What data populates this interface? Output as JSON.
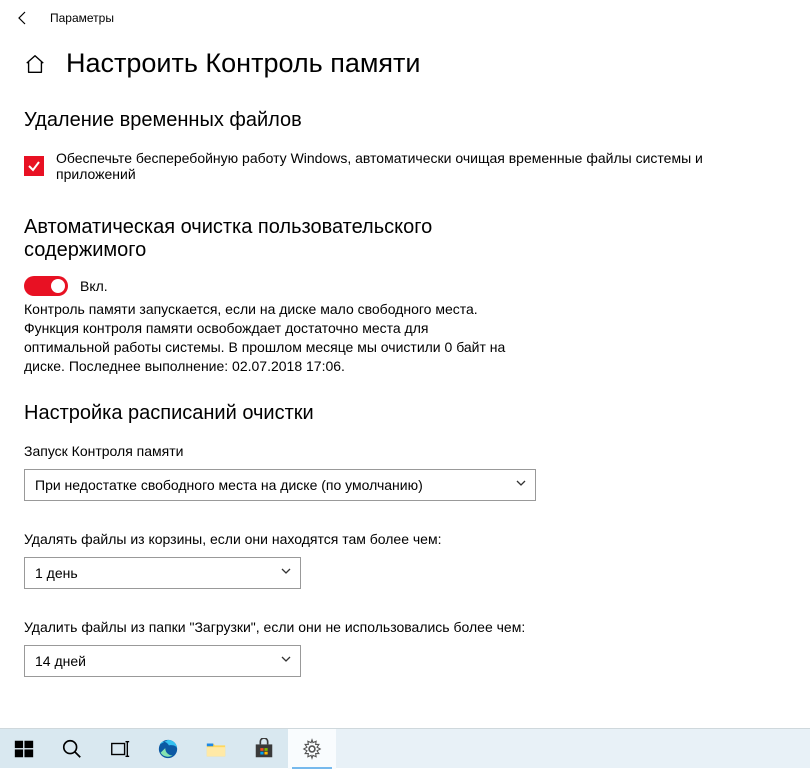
{
  "titlebar": {
    "label": "Параметры"
  },
  "page": {
    "title": "Настроить Контроль памяти"
  },
  "section_temp": {
    "title": "Удаление временных файлов",
    "checkbox_label": "Обеспечьте бесперебойную работу Windows, автоматически очищая временные файлы системы и приложений"
  },
  "section_auto": {
    "title": "Автоматическая очистка пользовательского содержимого",
    "toggle_state": "Вкл.",
    "description": "Контроль памяти запускается, если на диске мало свободного места. Функция контроля памяти освобождает достаточно места для оптимальной работы системы. В прошлом месяце мы очистили 0 байт на диске. Последнее выполнение: 02.07.2018 17:06."
  },
  "section_schedule": {
    "title": "Настройка расписаний очистки",
    "run_label": "Запуск Контроля памяти",
    "run_value": "При недостатке свободного места на диске (по умолчанию)",
    "recycle_label": "Удалять файлы из корзины, если они находятся там более чем:",
    "recycle_value": "1 день",
    "downloads_label": "Удалить файлы из папки \"Загрузки\", если они не использовались более чем:",
    "downloads_value": "14 дней"
  },
  "colors": {
    "accent": "#e81123"
  }
}
